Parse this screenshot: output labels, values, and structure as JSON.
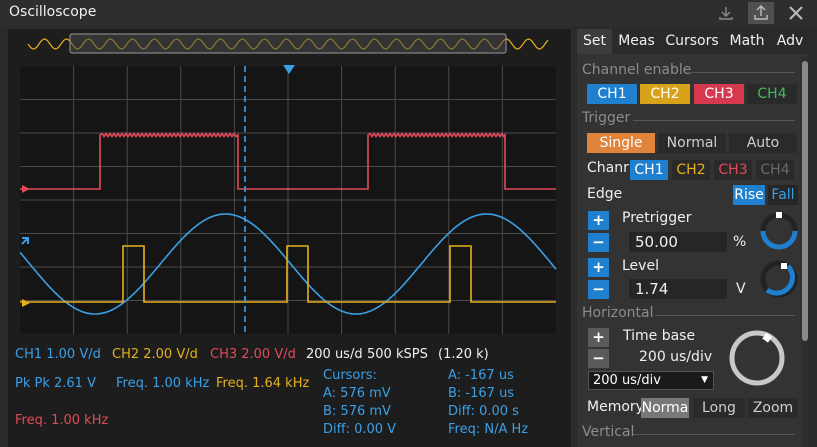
{
  "window": {
    "title": "Oscilloscope"
  },
  "icons": {
    "download": "download-icon",
    "export": "export-icon",
    "close": "close-icon"
  },
  "colors": {
    "ch1": "#3ba0e6",
    "ch2": "#e7b01c",
    "ch3": "#e04b5a",
    "ch4": "#3cbf5a",
    "accent": "#2080d0",
    "orange": "#e0843c"
  },
  "readouts": {
    "ch1_scale": "CH1 1.00 V/d",
    "ch2_scale": "CH2 2.00 V/d",
    "ch3_scale": "CH3 2.00 V/d",
    "timebase": "200 us/d",
    "samplerate": "500 kSPS",
    "samples": "(1.20 k)",
    "pkpk": "Pk Pk 2.61 V",
    "freq1": "Freq. 1.00 kHz",
    "freq2": "Freq. 1.64 kHz",
    "freq3": "Freq. 1.00 kHz",
    "cursors_title": "Cursors:",
    "cursor_a_v": "A: 576 mV",
    "cursor_b_v": "B: 576 mV",
    "cursor_diff_v": "Diff: 0.00 V",
    "cursor_a_t": "A: -167 us",
    "cursor_b_t": "B: -167 us",
    "cursor_diff_t": "Diff: 0.00 s",
    "cursor_freq": "Freq: N/A Hz"
  },
  "tabs": [
    "Set",
    "Meas",
    "Cursors",
    "Math",
    "Adv"
  ],
  "panel": {
    "channel_enable": "Channel enable",
    "channels": [
      "CH1",
      "CH2",
      "CH3",
      "CH4"
    ],
    "trigger": "Trigger",
    "trigger_modes": [
      "Single",
      "Normal",
      "Auto"
    ],
    "channel_label": "Chanr",
    "edge_label": "Edge",
    "edge_rise": "Rise",
    "edge_fall": "Fall",
    "pretrigger_label": "Pretrigger",
    "pretrigger_value": "50.00",
    "pretrigger_unit": "%",
    "level_label": "Level",
    "level_value": "1.74",
    "level_unit": "V",
    "horizontal": "Horizontal",
    "timebase_label": "Time base",
    "timebase_value": "200 us/div",
    "timebase_select": "200 us/div",
    "memory_label": "Memory",
    "memory_modes": [
      "Norma",
      "Long",
      "Zoom"
    ],
    "vertical": "Vertical",
    "plus": "+",
    "minus": "−"
  },
  "chart_data": {
    "type": "line",
    "x_divisions": 10,
    "y_divisions": 8,
    "series": [
      {
        "name": "CH1",
        "waveform": "sine",
        "frequency_khz": 1.0,
        "pk_pk_v": 2.61,
        "volts_per_div": 1.0
      },
      {
        "name": "CH2",
        "waveform": "pulse",
        "frequency_khz": 1.64,
        "volts_per_div": 2.0
      },
      {
        "name": "CH3",
        "waveform": "square",
        "frequency_khz": 1.0,
        "volts_per_div": 2.0
      }
    ],
    "trigger_cursor_time_us": -167
  }
}
